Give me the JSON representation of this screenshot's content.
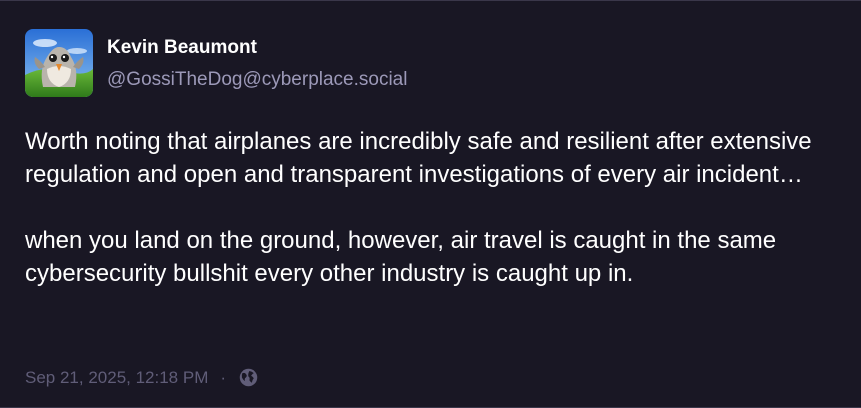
{
  "author": {
    "display_name": "Kevin Beaumont",
    "handle": "@GossiTheDog@cyberplace.social",
    "avatar_icon": "porg-avatar"
  },
  "post": {
    "paragraphs": [
      "Worth noting that airplanes are incredibly safe and resilient after extensive regulation and open and transparent investigations of every air incident…",
      "when you land on the ground, however, air travel is caught in the same cybersecurity bullshit every other industry is caught up in."
    ]
  },
  "meta": {
    "timestamp": "Sep 21, 2025, 12:18 PM",
    "separator": "·",
    "visibility_icon": "globe-icon"
  },
  "colors": {
    "background": "#191724",
    "text": "#ffffff",
    "handle": "#9c99b8",
    "meta": "#605d78",
    "border": "#3a374a"
  }
}
